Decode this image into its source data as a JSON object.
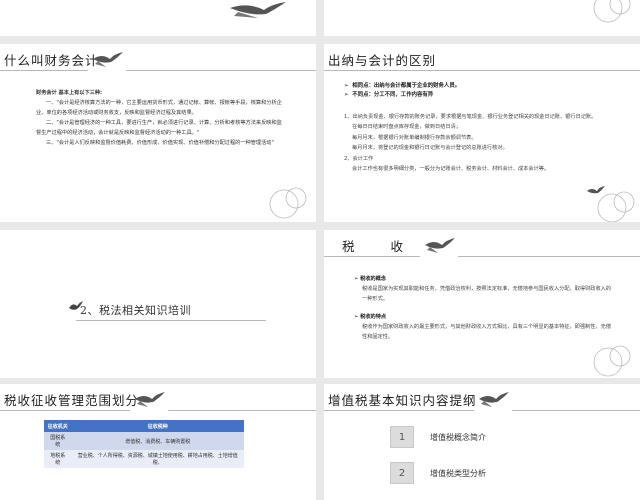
{
  "slides": {
    "s3": {
      "title": "什么叫财务会计",
      "lead": "财务会计  基本上有以下三种:",
      "paragraphs": [
        "一、\"会计是经济核算方法的一种，它主要运用货币形式，通过记帐、算帐、报帐等手段，核算和分析企业、单位的各项经济活动或财务收支，反映和监督经济过程及其结果。",
        "二、\"会计是管理经济的一种工具，要进行生产，就必须进行记录、计算、分析和考核等方法来反映和监督生产过程中的经济活动，会计就是反映和监督经济活动的一种工具。\"",
        "三、\"会计是人们反映和监督价值耗费、价值形成、价值实现、价值补偿和分配过程的一种管理活动\""
      ]
    },
    "s4": {
      "title": "出纳与会计的区别",
      "bullets": [
        "相同点：出纳与会计都属于企业的财务人员。",
        "不同点：分工不同，工作内容有异"
      ],
      "lines": [
        "1、出纳负责现金、银行存款的账务记录，要求根据与笔现金、银行业务登记相关的现金日记账、银行日记账。",
        "在每日日结束时盘点库存现金，做到日结日清；",
        "每月月末，根据银行对账单编制银行存款余额调节表。",
        "每月月末，将登记的现金和银行日记账与会计登记的总账进行核对。",
        "2、会计工作",
        "会计工作也有很多明细分类，一般分为记账会计、税务会计、材料会计、成本会计等。"
      ]
    },
    "s5": {
      "section": "2、税法相关知识培训"
    },
    "s6": {
      "title": "税    收",
      "h1": "税收的概念",
      "p1": "税收是国家为实现其职能和任务，凭借政治权利，按照法定标准，无偿地参与国民收入分配，取得财政收入的一种形式。",
      "h2": "税收的特点",
      "p2": "税收作为国家财政收入的最主要形式，与其他财政收入方式相比，具有三个明显的基本特征，即强制性、无偿性和固定性。"
    },
    "s7": {
      "title": "税收征收管理范围划分",
      "table": {
        "headers": [
          "征收机关",
          "征收税种"
        ],
        "rows": [
          [
            "国税系统",
            "增值税、消费税、车辆购置税"
          ],
          [
            "地税系统",
            "营业税、个人所得税、资源税、城镇土地使用税、耕地占用税、土地增值税、"
          ]
        ]
      }
    },
    "s8": {
      "title": "增值税基本知识内容提纲",
      "items": [
        {
          "num": "1",
          "text": "增值税概念简介"
        },
        {
          "num": "2",
          "text": "增值税类型分析"
        }
      ]
    }
  },
  "colors": {
    "table_header": "#4472c4",
    "row_dark": "#cfd8ec",
    "row_light": "#e8edf7"
  },
  "icons": [
    "bird-icon",
    "circles-decoration"
  ]
}
